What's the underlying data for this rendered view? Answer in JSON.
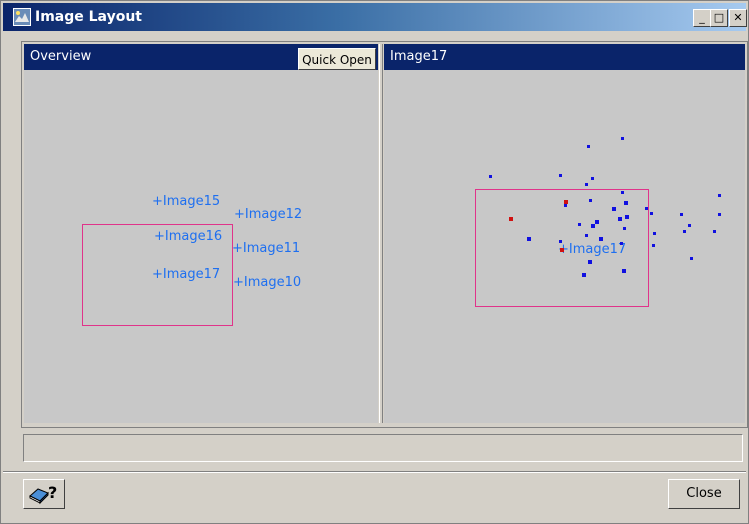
{
  "window": {
    "title": "Image Layout",
    "minimize_glyph": "_",
    "maximize_glyph": "□",
    "close_glyph": "✕"
  },
  "overview": {
    "header_label": "Overview",
    "quick_open_label": "Quick Open",
    "images": [
      {
        "name": "+Image15"
      },
      {
        "name": "+Image12"
      },
      {
        "name": "+Image16"
      },
      {
        "name": "+Image11"
      },
      {
        "name": "+Image17"
      },
      {
        "name": "+Image10"
      }
    ]
  },
  "detail": {
    "header_label": "Image17",
    "image_label": "+Image17"
  },
  "status_bar": {
    "text": ""
  },
  "footer": {
    "help_icon": "help-book-icon",
    "help_glyph": "?",
    "close_label": "Close"
  },
  "colors": {
    "header_bg": "#0a246a",
    "label": "#1e6ff0",
    "selection_rect": "#e0338a",
    "point_blue": "#1010e0",
    "point_red": "#d01010"
  }
}
